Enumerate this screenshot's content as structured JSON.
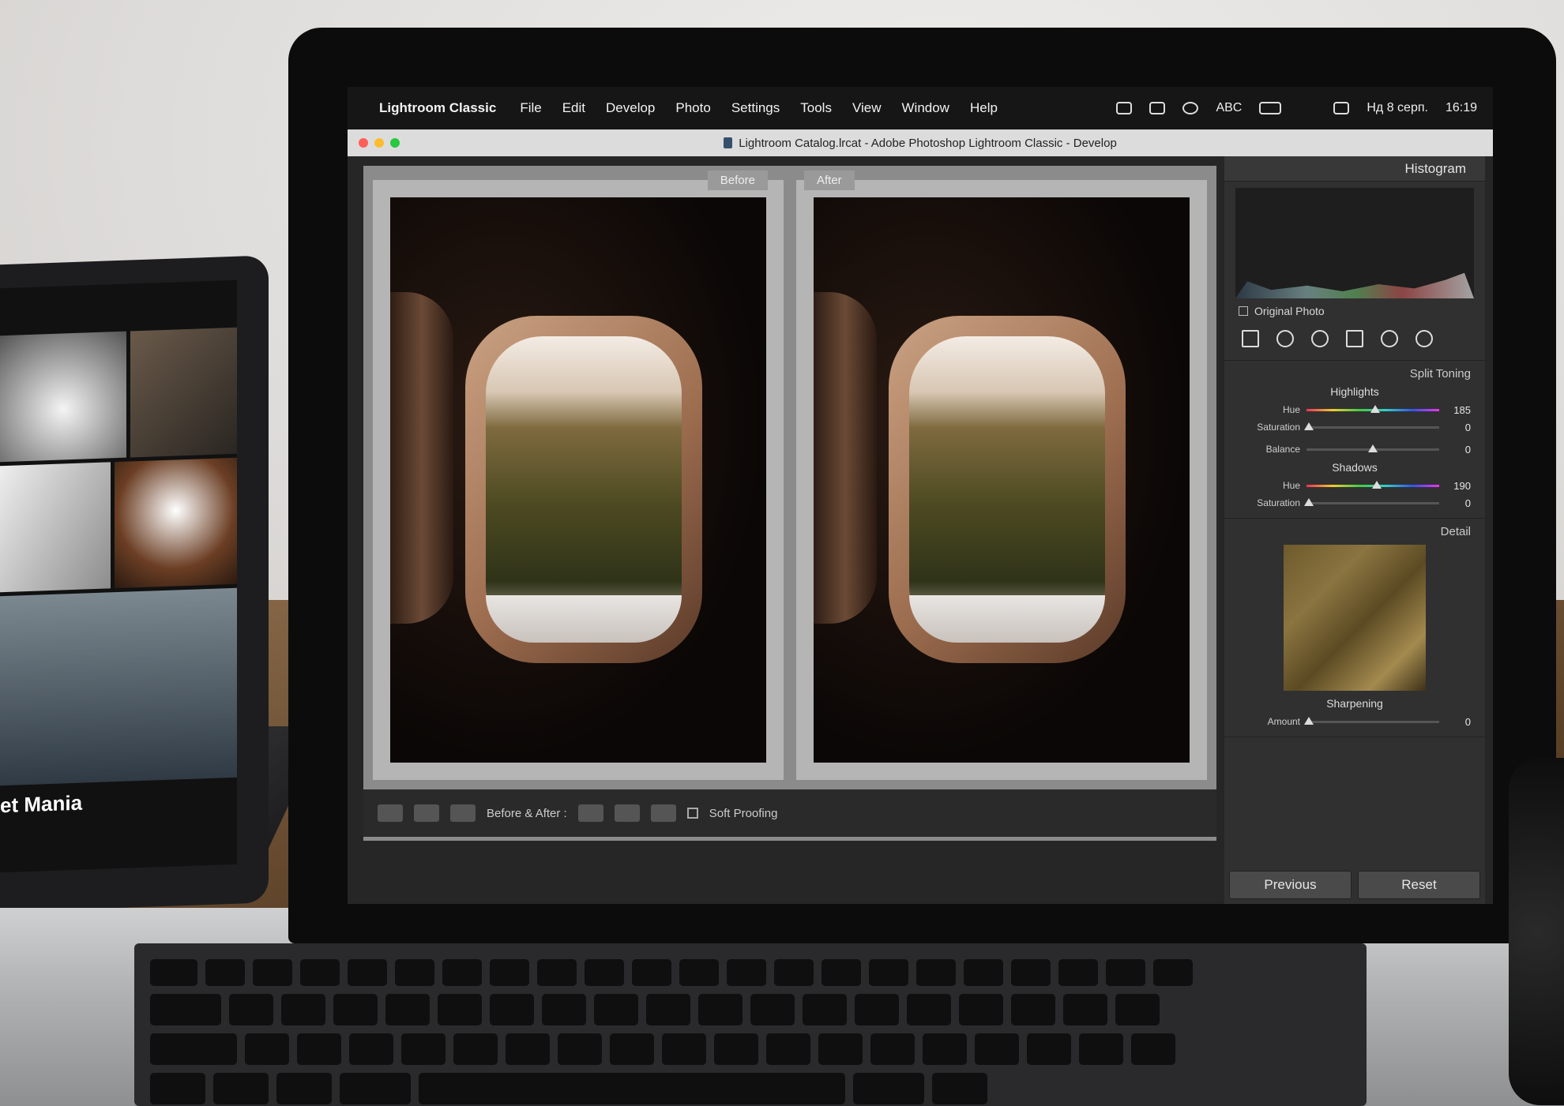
{
  "menubar": {
    "app_name": "Lightroom Classic",
    "menus": [
      "File",
      "Edit",
      "Develop",
      "Photo",
      "Settings",
      "Tools",
      "View",
      "Window",
      "Help"
    ],
    "status": {
      "input_source": "ABC",
      "date": "Нд 8 серп.",
      "time": "16:19"
    }
  },
  "window": {
    "title": "Lightroom Catalog.lrcat - Adobe Photoshop Lightroom Classic - Develop"
  },
  "compare": {
    "before_label": "Before",
    "after_label": "After",
    "toolbar": {
      "before_after_label": "Before & After :",
      "soft_proofing_label": "Soft Proofing"
    }
  },
  "panel": {
    "histogram": {
      "title": "Histogram",
      "original_photo_label": "Original Photo"
    },
    "split_toning": {
      "title": "Split Toning",
      "highlights": {
        "title": "Highlights",
        "hue_label": "Hue",
        "hue_value": "185",
        "saturation_label": "Saturation",
        "saturation_value": "0",
        "hue_pos": 0.52,
        "sat_pos": 0.02
      },
      "balance": {
        "label": "Balance",
        "value": "0",
        "pos": 0.5
      },
      "shadows": {
        "title": "Shadows",
        "hue_label": "Hue",
        "hue_value": "190",
        "saturation_label": "Saturation",
        "saturation_value": "0",
        "hue_pos": 0.53,
        "sat_pos": 0.02
      }
    },
    "detail": {
      "title": "Detail",
      "sharpening_title": "Sharpening",
      "amount_label": "Amount",
      "amount_value": "0",
      "amount_pos": 0.02
    },
    "buttons": {
      "previous": "Previous",
      "reset": "Reset"
    }
  },
  "ipad": {
    "caption": "et Mania"
  }
}
